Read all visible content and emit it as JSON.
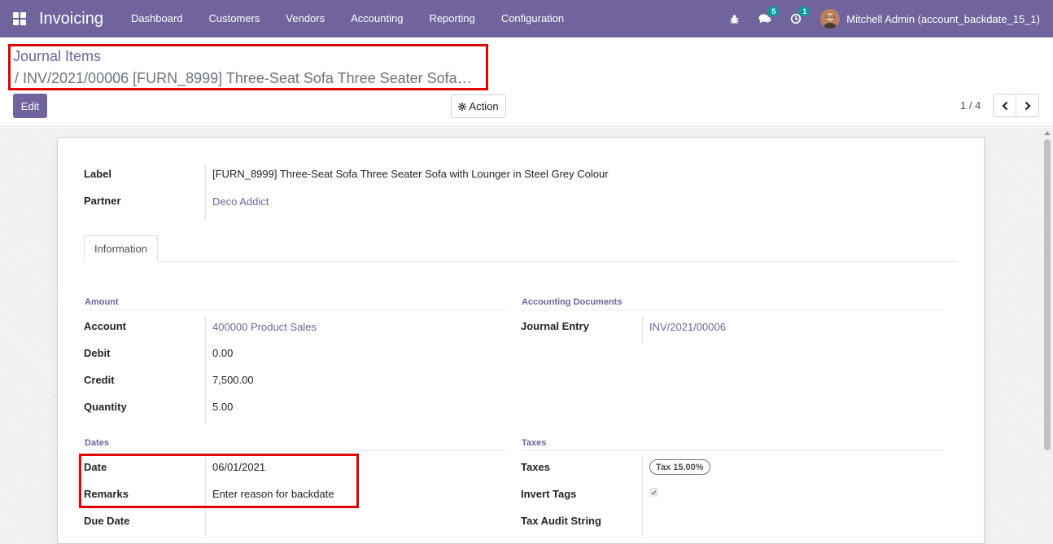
{
  "navbar": {
    "app_title": "Invoicing",
    "menu": [
      "Dashboard",
      "Customers",
      "Vendors",
      "Accounting",
      "Reporting",
      "Configuration"
    ],
    "chat_count": "5",
    "activity_count": "1",
    "user": "Mitchell Admin (account_backdate_15_1)",
    "accent": "#71639e"
  },
  "breadcrumb": {
    "parent": "Journal Items",
    "current": "/ INV/2021/00006 [FURN_8999] Three-Seat Sofa Three Seater Sofa…"
  },
  "toolbar": {
    "edit_label": "Edit",
    "action_label": "Action",
    "pager": "1 / 4"
  },
  "form": {
    "label_label": "Label",
    "label_value": "[FURN_8999] Three-Seat Sofa Three Seater Sofa with Lounger in Steel Grey Colour",
    "partner_label": "Partner",
    "partner_value": "Deco Addict",
    "tab": "Information",
    "amount": {
      "title": "Amount",
      "account_label": "Account",
      "account_value": "400000 Product Sales",
      "debit_label": "Debit",
      "debit_value": "0.00",
      "credit_label": "Credit",
      "credit_value": "7,500.00",
      "quantity_label": "Quantity",
      "quantity_value": "5.00"
    },
    "accounting_docs": {
      "title": "Accounting Documents",
      "journal_entry_label": "Journal Entry",
      "journal_entry_value": "INV/2021/00006"
    },
    "dates": {
      "title": "Dates",
      "date_label": "Date",
      "date_value": "06/01/2021",
      "remarks_label": "Remarks",
      "remarks_value": "Enter reason for backdate",
      "due_date_label": "Due Date"
    },
    "taxes": {
      "title": "Taxes",
      "taxes_label": "Taxes",
      "tax_tag": "Tax 15.00%",
      "invert_tags_label": "Invert Tags",
      "tax_audit_label": "Tax Audit String"
    }
  }
}
